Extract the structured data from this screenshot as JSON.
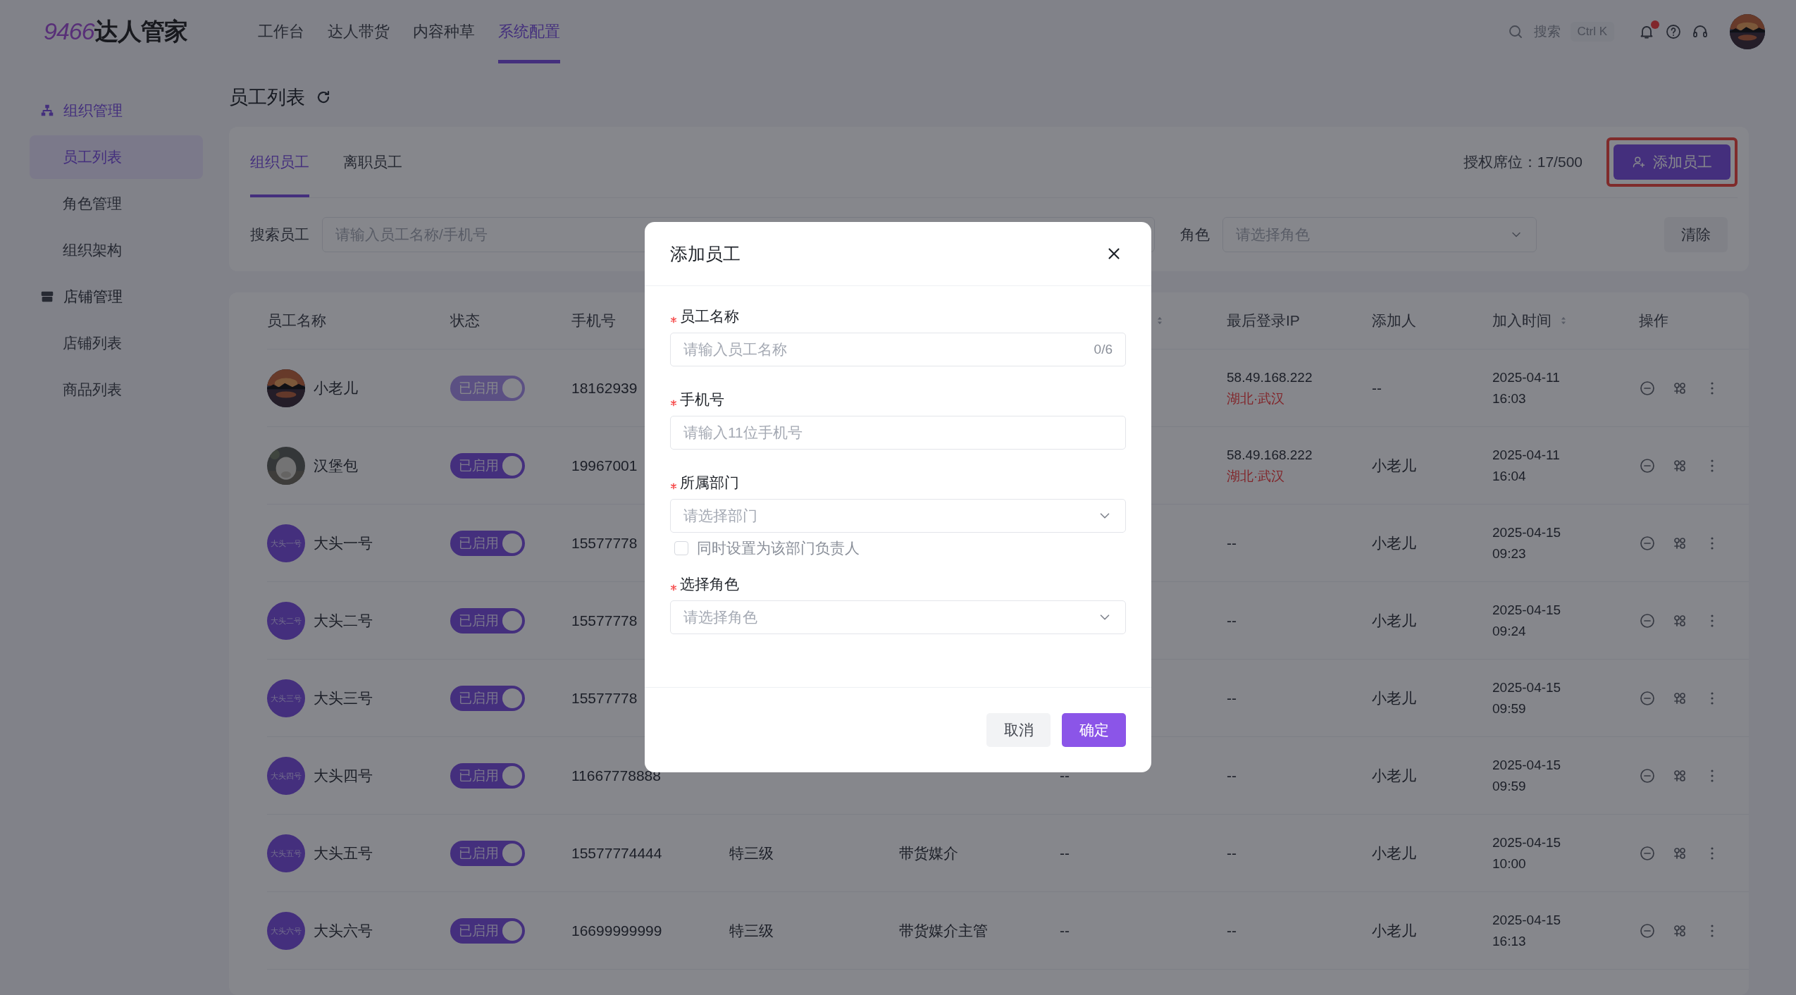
{
  "topbar": {
    "logo": {
      "mark": "9466",
      "text": "达人管家"
    },
    "nav": [
      {
        "label": "工作台",
        "selected": false
      },
      {
        "label": "达人带货",
        "selected": false
      },
      {
        "label": "内容种草",
        "selected": false
      },
      {
        "label": "系统配置",
        "selected": true
      }
    ],
    "search": {
      "label": "搜索",
      "shortcut": "Ctrl K"
    },
    "notifications": {
      "unread": true
    }
  },
  "sidebar": {
    "groups": [
      {
        "label": "组织管理",
        "kind": "org",
        "items": [
          {
            "label": "员工列表",
            "selected": true
          },
          {
            "label": "角色管理",
            "selected": false
          },
          {
            "label": "组织架构",
            "selected": false
          }
        ]
      },
      {
        "label": "店铺管理",
        "kind": "store",
        "items": [
          {
            "label": "店铺列表",
            "selected": false
          },
          {
            "label": "商品列表",
            "selected": false
          }
        ]
      }
    ]
  },
  "page": {
    "title": "员工列表",
    "tabs": [
      {
        "label": "组织员工",
        "selected": true
      },
      {
        "label": "离职员工",
        "selected": false
      }
    ],
    "seats": "授权席位：17/500",
    "add_button": {
      "label": "添加员工",
      "highlighted": true
    },
    "filters": {
      "search_label": "搜索员工",
      "search_placeholder": "请输入员工名称/手机号",
      "role_label": "角色",
      "role_placeholder": "请选择角色",
      "clear": "清除"
    },
    "table": {
      "columns": [
        {
          "kind": "name",
          "label": "员工名称"
        },
        {
          "kind": "status",
          "label": "状态"
        },
        {
          "kind": "phone",
          "label": "手机号"
        },
        {
          "kind": "level"
        },
        {
          "kind": "dept"
        },
        {
          "kind": "col_6",
          "sortable": true
        },
        {
          "kind": "ip",
          "label": "最后登录IP"
        },
        {
          "kind": "added_by",
          "label": "添加人"
        },
        {
          "kind": "joined",
          "label": "加入时间",
          "sortable": true
        },
        {
          "kind": "ops",
          "label": "操作"
        }
      ],
      "rows": [
        {
          "name": "小老儿",
          "status": {
            "label": "已启用",
            "on": true,
            "disabled": true
          },
          "phone": "18162939",
          "ip": "58.49.168.222",
          "location": "湖北·武汉",
          "added_by": "--",
          "joined_date": "2025-04-11",
          "joined_time": "16:03"
        },
        {
          "name": "汉堡包",
          "status": {
            "label": "已启用",
            "on": true,
            "disabled": false
          },
          "phone": "19967001",
          "ip": "58.49.168.222",
          "location": "湖北·武汉",
          "added_by": "小老儿",
          "joined_date": "2025-04-11",
          "joined_time": "16:04"
        },
        {
          "avatar": {
            "kind": "initials",
            "text": "大头一号"
          },
          "name": "大头一号",
          "status": {
            "label": "已启用",
            "on": true,
            "disabled": false
          },
          "phone": "15577778",
          "ip": "--",
          "added_by": "小老儿",
          "joined_date": "2025-04-15",
          "joined_time": "09:23"
        },
        {
          "avatar": {
            "kind": "initials",
            "text": "大头二号"
          },
          "name": "大头二号",
          "status": {
            "label": "已启用",
            "on": true,
            "disabled": false
          },
          "phone": "15577778",
          "ip": "--",
          "added_by": "小老儿",
          "joined_date": "2025-04-15",
          "joined_time": "09:24"
        },
        {
          "avatar": {
            "kind": "initials",
            "text": "大头三号"
          },
          "name": "大头三号",
          "status": {
            "label": "已启用",
            "on": true,
            "disabled": false
          },
          "phone": "15577778",
          "ip": "--",
          "added_by": "小老儿",
          "joined_date": "2025-04-15",
          "joined_time": "09:59"
        },
        {
          "avatar": {
            "kind": "initials",
            "text": "大头四号"
          },
          "name": "大头四号",
          "status": {
            "label": "已启用",
            "on": true,
            "disabled": false
          },
          "phone": "11667778888",
          "col_6": "--",
          "ip": "--",
          "added_by": "小老儿",
          "joined_date": "2025-04-15",
          "joined_time": "09:59"
        },
        {
          "avatar": {
            "kind": "initials",
            "text": "大头五号"
          },
          "name": "大头五号",
          "status": {
            "label": "已启用",
            "on": true,
            "disabled": false
          },
          "phone": "15577774444",
          "level": "特三级",
          "dept": "带货媒介",
          "col_6": "--",
          "ip": "--",
          "added_by": "小老儿",
          "joined_date": "2025-04-15",
          "joined_time": "10:00"
        },
        {
          "avatar": {
            "kind": "initials",
            "text": "大头六号"
          },
          "name": "大头六号",
          "status": {
            "label": "已启用",
            "on": true,
            "disabled": false
          },
          "phone": "16699999999",
          "level": "特三级",
          "dept": "带货媒介主管",
          "col_6": "--",
          "ip": "--",
          "added_by": "小老儿",
          "joined_date": "2025-04-15",
          "joined_time": "16:13"
        }
      ]
    }
  },
  "modal": {
    "title": "添加员工",
    "fields": [
      {
        "kind": "input",
        "label": "员工名称",
        "required": true,
        "placeholder": "请输入员工名称",
        "counter": "0/6"
      },
      {
        "kind": "input",
        "label": "手机号",
        "required": true,
        "placeholder": "请输入11位手机号"
      },
      {
        "kind": "select",
        "label": "所属部门",
        "required": true,
        "placeholder": "请选择部门",
        "checkbox": {
          "label": "同时设置为该部门负责人",
          "checked": false
        }
      },
      {
        "kind": "select",
        "label": "选择角色",
        "required": true,
        "placeholder": "请选择角色"
      }
    ],
    "buttons": [
      {
        "label": "取消",
        "kind": "secondary"
      },
      {
        "label": "确定",
        "kind": "primary"
      }
    ]
  }
}
